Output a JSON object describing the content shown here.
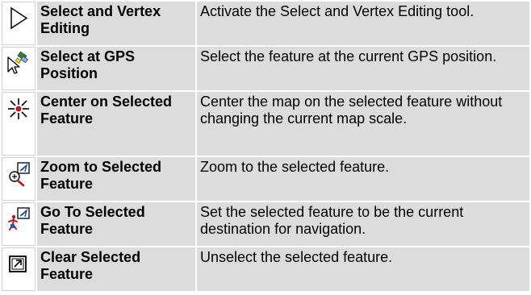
{
  "tools": [
    {
      "icon": "select-arrow-icon",
      "name": "Select and Vertex Editing",
      "description": "Activate the Select and Vertex Editing tool."
    },
    {
      "icon": "gps-select-icon",
      "name": "Select at GPS Position",
      "description": "Select the feature at the current GPS position."
    },
    {
      "icon": "center-on-feature-icon",
      "name": "Center on Selected Feature",
      "description": "Center the map on the selected feature without changing the current map scale."
    },
    {
      "icon": "zoom-to-feature-icon",
      "name": "Zoom to Selected Feature",
      "description": "Zoom to the selected feature."
    },
    {
      "icon": "go-to-feature-icon",
      "name": "Go To Selected Feature",
      "description": "Set the selected feature to be the current destination for navigation."
    },
    {
      "icon": "clear-selection-icon",
      "name": "Clear Selected Feature",
      "description": "Unselect the selected feature."
    }
  ]
}
